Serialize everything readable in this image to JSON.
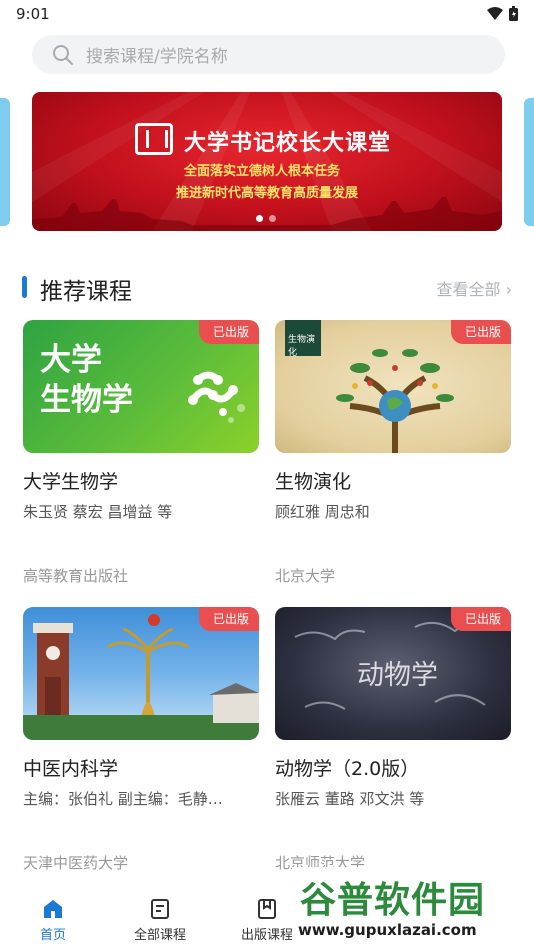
{
  "status_bar": {
    "time": "9:01"
  },
  "search": {
    "placeholder": "搜索课程/学院名称"
  },
  "banner": {
    "title": "大学书记校长大课堂",
    "subtitle_1": "全面落实立德树人根本任务",
    "subtitle_2": "推进新时代高等教育高质量发展",
    "slide_count": 2,
    "active_slide": 1
  },
  "section": {
    "title": "推荐课程",
    "view_all": "查看全部 ›"
  },
  "courses": [
    {
      "badge": "已出版",
      "cover_text_1": "大学",
      "cover_text_2": "生物学",
      "title": "大学生物学",
      "authors": "朱玉贤 蔡宏 昌增益 等",
      "publisher": "高等教育出版社"
    },
    {
      "badge": "已出版",
      "cover_text": "生物演化",
      "title": "生物演化",
      "authors": "顾红雅 周忠和",
      "publisher": "北京大学"
    },
    {
      "badge": "已出版",
      "title": "中医内科学",
      "authors": "主编：张伯礼 副主编：毛静…",
      "publisher": "天津中医药大学"
    },
    {
      "badge": "已出版",
      "cover_text": "动物学",
      "title": "动物学（2.0版）",
      "authors": "张雁云 董路 邓文洪 等",
      "publisher": "北京师范大学"
    }
  ],
  "tabbar": {
    "tabs": [
      {
        "label": "首页",
        "icon": "home-icon",
        "active": true
      },
      {
        "label": "全部课程",
        "icon": "document-icon",
        "active": false
      },
      {
        "label": "出版课程",
        "icon": "bookmark-icon",
        "active": false
      }
    ]
  },
  "watermark": {
    "text": "谷普软件园",
    "url": "www.gupuxlazai.com"
  },
  "colors": {
    "accent": "#1a78d6",
    "badge": "#e94f4f",
    "banner_red": "#c0101c"
  }
}
